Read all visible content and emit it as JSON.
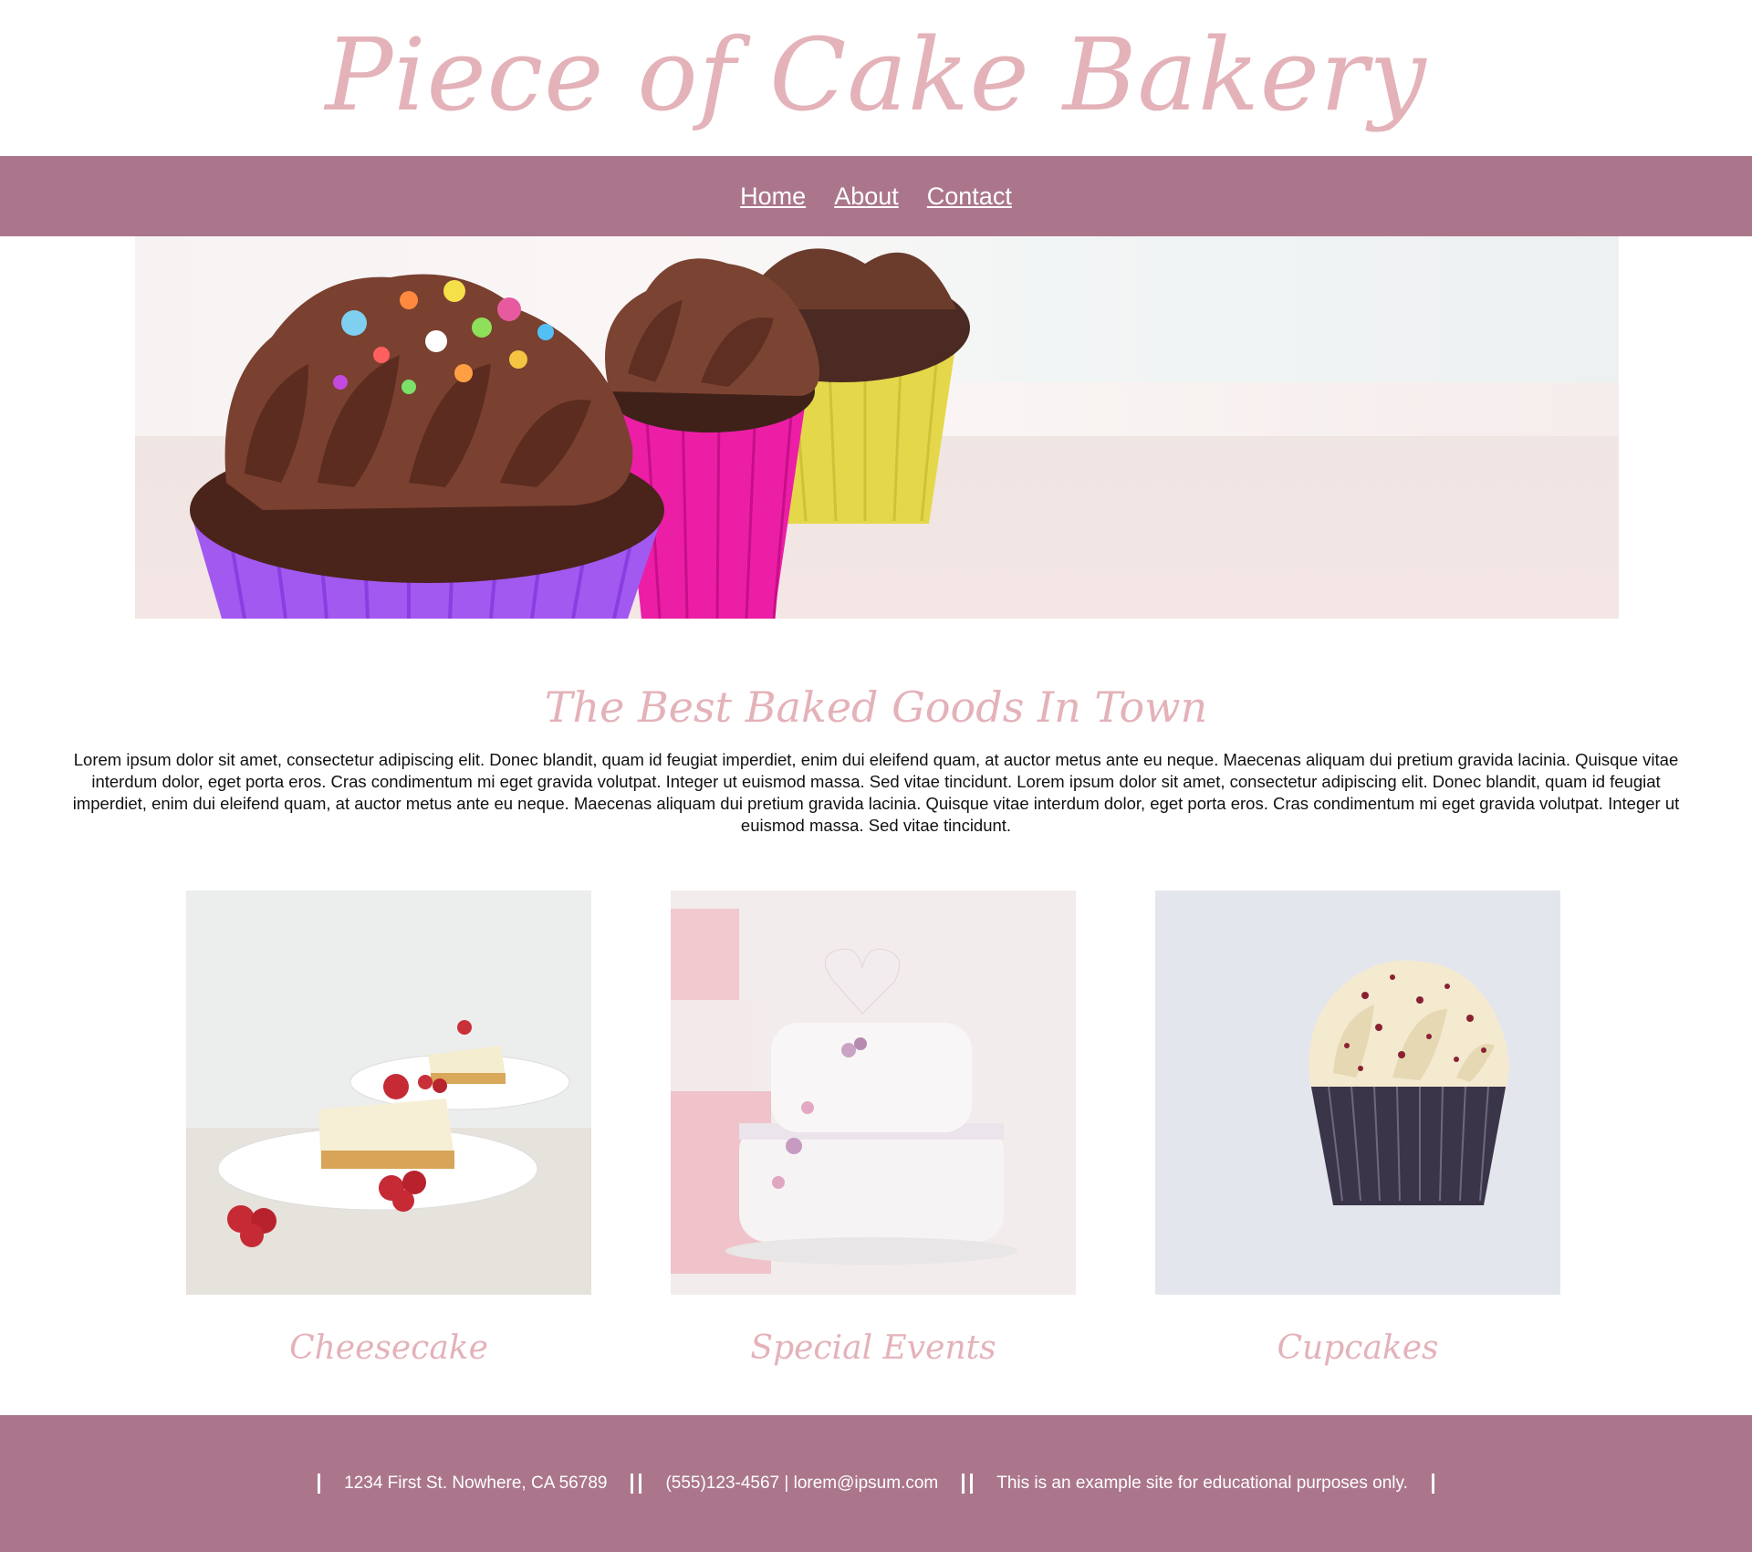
{
  "header": {
    "site_title": "Piece of Cake Bakery"
  },
  "nav": {
    "items": [
      {
        "label": "Home"
      },
      {
        "label": "About"
      },
      {
        "label": "Contact"
      }
    ]
  },
  "main": {
    "tagline": "The Best Baked Goods In Town",
    "intro": "Lorem ipsum dolor sit amet, consectetur adipiscing elit. Donec blandit, quam id feugiat imperdiet, enim dui eleifend quam, at auctor metus ante eu neque. Maecenas aliquam dui pretium gravida lacinia. Quisque vitae interdum dolor, eget porta eros. Cras condimentum mi eget gravida volutpat. Integer ut euismod massa. Sed vitae tincidunt. Lorem ipsum dolor sit amet, consectetur adipiscing elit. Donec blandit, quam id feugiat imperdiet, enim dui eleifend quam, at auctor metus ante eu neque. Maecenas aliquam dui pretium gravida lacinia. Quisque vitae interdum dolor, eget porta eros. Cras condimentum mi eget gravida volutpat. Integer ut euismod massa. Sed vitae tincidunt."
  },
  "features": [
    {
      "caption": "Cheesecake"
    },
    {
      "caption": "Special Events"
    },
    {
      "caption": "Cupcakes"
    }
  ],
  "footer": {
    "address": "1234 First St. Nowhere, CA 56789",
    "contact": "(555)123-4567 | lorem@ipsum.com",
    "note": "This is an example site for educational purposes only."
  },
  "colors": {
    "nav_bar": "#ab768c",
    "accent_pink": "#e4b2b9",
    "text": "#111111"
  }
}
